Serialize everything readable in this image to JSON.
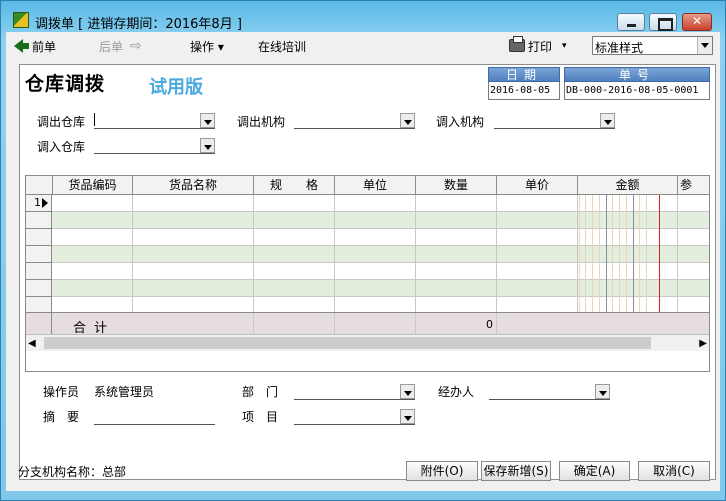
{
  "window": {
    "title": "调拨单 [ 进销存期间：2016年8月 ]"
  },
  "toolbar": {
    "prev": "前单",
    "next": "后单",
    "operate": "操作",
    "operate_dd": "▾",
    "training": "在线培训",
    "print": "打印",
    "print_dd": "▾",
    "style_value": "标准样式"
  },
  "form": {
    "title": "仓库调拨",
    "trial": "试用版",
    "date_label": "日期",
    "date_value": "2016-08-05",
    "no_label": "单号",
    "no_value": "DB-000-2016-08-05-0001",
    "out_warehouse_label": "调出仓库",
    "out_org_label": "调出机构",
    "in_org_label": "调入机构",
    "in_warehouse_label": "调入仓库"
  },
  "grid": {
    "columns": [
      "货品编码",
      "货品名称",
      "规　　格",
      "单位",
      "数量",
      "单价",
      "金额",
      "参"
    ],
    "first_row_num": "1",
    "total_label": "合计",
    "total_qty": "0"
  },
  "footer": {
    "operator_label": "操作员",
    "operator_value": "系统管理员",
    "dept_label": "部　门",
    "handler_label": "经办人",
    "summary_label": "摘　要",
    "project_label": "项　目"
  },
  "status": {
    "branch": "分支机构名称：总部"
  },
  "buttons": {
    "attach": "附件(O)",
    "save_new": "保存新增(S)",
    "ok": "确定(A)",
    "cancel": "取消(C)"
  }
}
